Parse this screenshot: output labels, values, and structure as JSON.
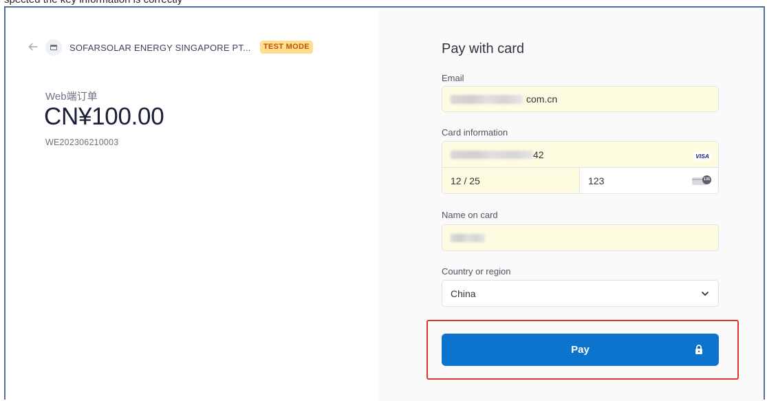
{
  "top_strip": {
    "text": "spected the key information is correctly"
  },
  "merchant": {
    "name": "SOFARSOLAR ENERGY SINGAPORE PT...",
    "badge": "TEST MODE"
  },
  "order": {
    "product_name": "Web端订单",
    "amount": "CN¥100.00",
    "order_id": "WE202306210003"
  },
  "form": {
    "heading": "Pay with card",
    "email": {
      "label": "Email",
      "value_visible": "com.cn"
    },
    "card": {
      "label": "Card information",
      "number_visible": "42",
      "brand": "VISA",
      "expiry": "12 / 25",
      "cvc": "123",
      "cvc_icon_text": "135"
    },
    "name": {
      "label": "Name on card"
    },
    "country": {
      "label": "Country or region",
      "value": "China"
    },
    "pay_label": "Pay"
  },
  "icons": {
    "back": "arrow-left-icon",
    "store": "store-icon",
    "card_brand": "visa-icon",
    "cvc": "cvc-card-icon",
    "dropdown": "chevron-down-icon",
    "lock": "lock-icon"
  },
  "colors": {
    "pay_button": "#0d74ce",
    "autofill_bg": "#fdfbe0",
    "test_badge_bg": "#ffde92",
    "test_badge_text": "#bb5504",
    "highlight_border": "#e03131",
    "frame_border": "#4a6fa0"
  }
}
